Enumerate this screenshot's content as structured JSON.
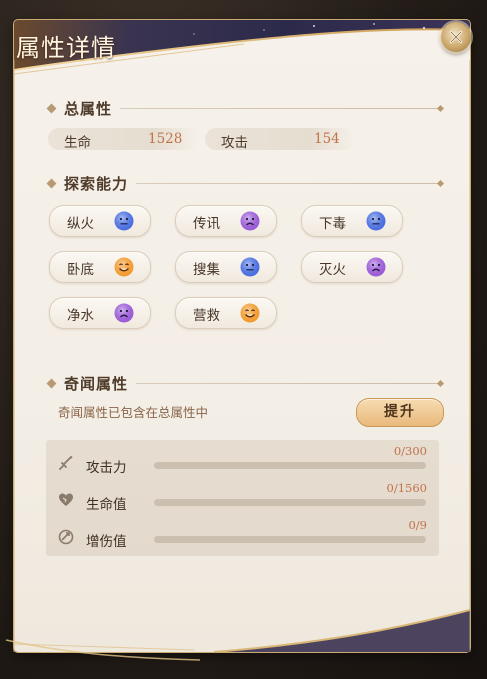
{
  "title": "属性详情",
  "sections": {
    "total": {
      "title": "总属性",
      "stats": [
        {
          "label": "生命",
          "value": "1528"
        },
        {
          "label": "攻击",
          "value": "154"
        }
      ]
    },
    "explore": {
      "title": "探索能力",
      "abilities": [
        {
          "label": "纵火",
          "mood": "neutral",
          "color": "#4a6ee0"
        },
        {
          "label": "传讯",
          "mood": "sad",
          "color": "#9a5ad6"
        },
        {
          "label": "下毒",
          "mood": "neutral",
          "color": "#4a6ee0"
        },
        {
          "label": "卧底",
          "mood": "happy",
          "color": "#f29a2e"
        },
        {
          "label": "搜集",
          "mood": "neutral",
          "color": "#4a6ee0"
        },
        {
          "label": "灭火",
          "mood": "sad",
          "color": "#9a5ad6"
        },
        {
          "label": "净水",
          "mood": "sad",
          "color": "#9a5ad6"
        },
        {
          "label": "营救",
          "mood": "happy",
          "color": "#f29a2e"
        }
      ]
    },
    "rare": {
      "title": "奇闻属性",
      "description": "奇闻属性已包含在总属性中",
      "upgrade_label": "提升",
      "attrs": [
        {
          "label": "攻击力",
          "value": "0/300",
          "progress": 0,
          "icon": "sword-icon"
        },
        {
          "label": "生命值",
          "value": "0/1560",
          "progress": 0,
          "icon": "heart-icon"
        },
        {
          "label": "增伤值",
          "value": "0/9",
          "progress": 0,
          "icon": "damage-boost-icon"
        }
      ]
    }
  }
}
